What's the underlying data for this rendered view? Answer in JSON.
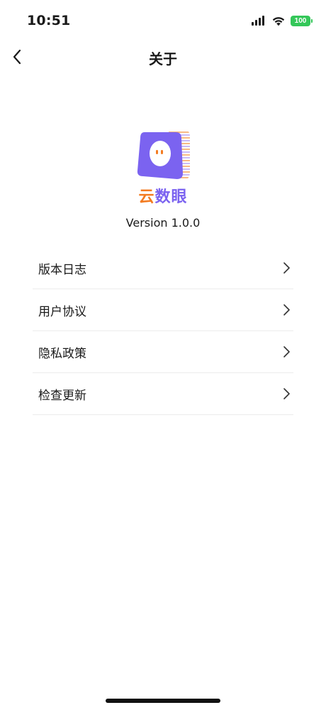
{
  "status_bar": {
    "time": "10:51",
    "battery": "100",
    "icons": [
      "signal-icon",
      "wifi-icon",
      "battery-icon"
    ]
  },
  "nav": {
    "title": "关于",
    "back_icon": "chevron-left-icon"
  },
  "app": {
    "name_part1": "云",
    "name_part2": "数眼",
    "version": "Version 1.0.0",
    "logo_icon": "app-logo-icon"
  },
  "menu": {
    "items": [
      {
        "label": "版本日志"
      },
      {
        "label": "用户协议"
      },
      {
        "label": "隐私政策"
      },
      {
        "label": "检查更新"
      }
    ],
    "item_icon": "chevron-right-icon"
  },
  "colors": {
    "accent_orange": "#f37b21",
    "accent_purple": "#7b63f0",
    "battery_green": "#34c759",
    "divider": "#ececec"
  }
}
